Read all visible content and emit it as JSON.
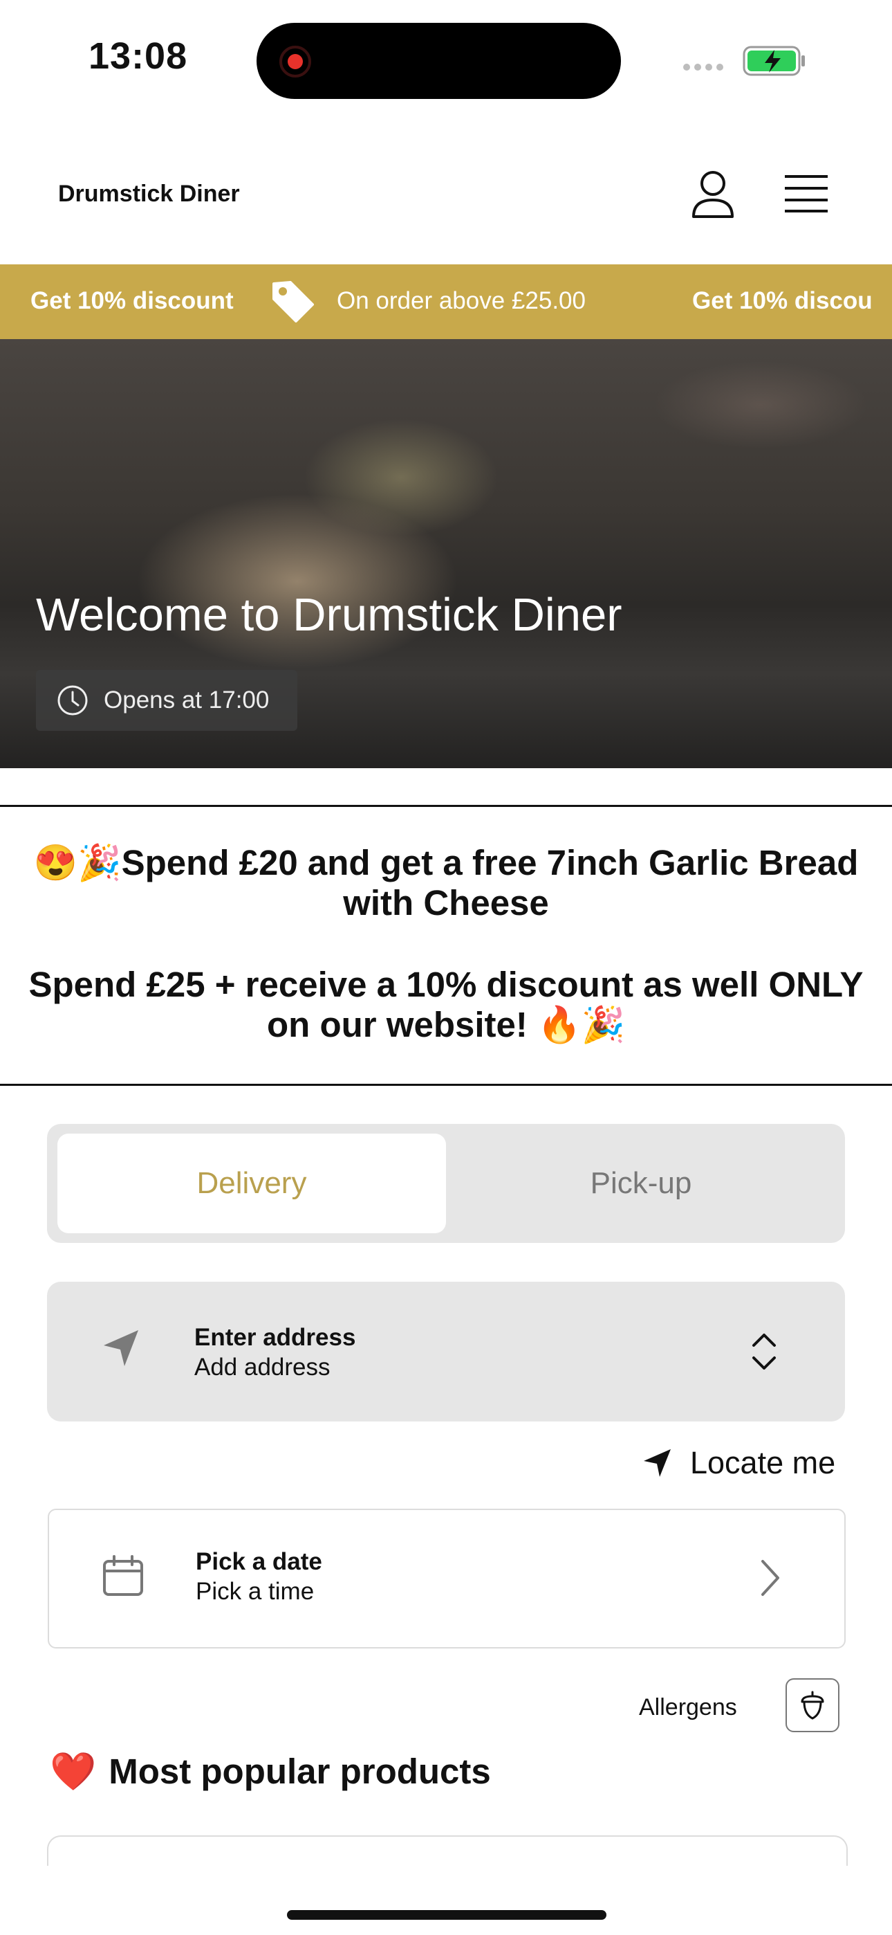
{
  "status_bar": {
    "time": "13:08"
  },
  "header": {
    "brand": "Drumstick Diner"
  },
  "discount_banner": {
    "title": "Get 10% discount",
    "condition": "On order above £25.00",
    "repeat_title": "Get 10% discou"
  },
  "hero": {
    "title": "Welcome to Drumstick Diner",
    "hours": "Opens at 17:00"
  },
  "promo": {
    "line1": "😍🎉Spend £20 and get a free 7inch Garlic Bread with Cheese",
    "line2": "Spend £25 + receive a 10% discount as well ONLY on our website! 🔥🎉"
  },
  "order_mode": {
    "options": [
      "Delivery",
      "Pick-up"
    ],
    "selected": "Delivery"
  },
  "address": {
    "title": "Enter address",
    "subtitle": "Add address"
  },
  "locate": {
    "label": "Locate me"
  },
  "schedule": {
    "title": "Pick a date",
    "subtitle": "Pick a time"
  },
  "allergens": {
    "label": "Allergens"
  },
  "popular": {
    "heading": "Most popular products",
    "emoji": "❤️"
  },
  "colors": {
    "accent": "#c8a94b",
    "selected_tab_text": "#b9a04e",
    "battery": "#2fce5a"
  }
}
